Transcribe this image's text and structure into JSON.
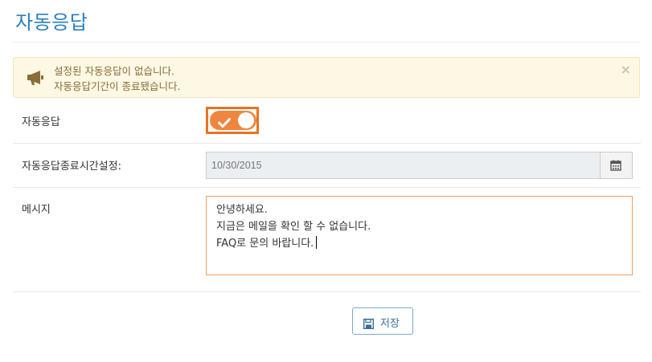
{
  "page": {
    "title": "자동응답"
  },
  "alert": {
    "icon": "megaphone-icon",
    "lines": [
      "설정된 자동응답이 없습니다.",
      "자동응답기간이 종료됐습니다."
    ],
    "close_label": "×"
  },
  "form": {
    "auto_reply": {
      "label": "자동응답",
      "enabled": true
    },
    "end_time": {
      "label": "자동응답종료시간설정:",
      "value": "10/30/2015",
      "icon": "calendar-icon"
    },
    "message": {
      "label": "메시지",
      "lines": [
        "안녕하세요.",
        "지금은 메일을 확인 할 수 없습니다.",
        "FAQ로 문의 바랍니다."
      ]
    }
  },
  "actions": {
    "save_label": "저장",
    "save_icon": "floppy-disk-icon"
  },
  "colors": {
    "accent": "#2a7fc0",
    "toggle": "#ef8640",
    "alert_bg": "#fcf8e3",
    "alert_text": "#8a6d3b"
  }
}
